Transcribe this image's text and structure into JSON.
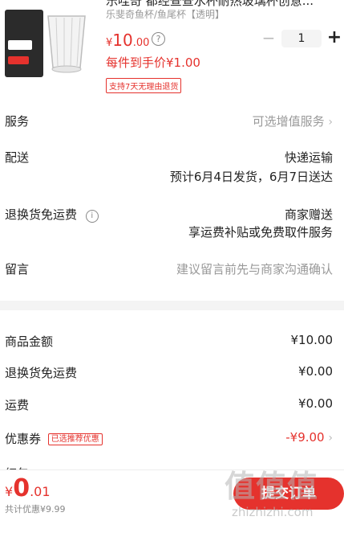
{
  "product": {
    "title": "乐哇奇 都经查查水杯耐热玻璃杯创意...",
    "spec": "乐斐奇鱼杯/鱼尾杯【透明】",
    "price": {
      "currency": "¥",
      "int": "10",
      "dec": ".00"
    },
    "info_icon": "?",
    "qty_minus": "−",
    "quantity": "1",
    "qty_plus": "+",
    "hand_price": "每件到手价¥1.00",
    "return_badge": "支持7天无理由退货"
  },
  "rows": {
    "service": {
      "label": "服务",
      "value": "可选增值服务"
    },
    "delivery": {
      "label": "配送",
      "value": "快递运输",
      "sub": "预计6月4日发货，6月7日送达"
    },
    "return_shipping": {
      "label": "退换货免运费",
      "value": "商家赠送",
      "sub": "享运费补贴或免费取件服务"
    },
    "message": {
      "label": "留言",
      "placeholder": "建议留言前先与商家沟通确认"
    }
  },
  "summary": {
    "goods_amount": {
      "label": "商品金额",
      "value": "¥10.00"
    },
    "return_fee": {
      "label": "退换货免运费",
      "value": "¥0.00"
    },
    "shipping": {
      "label": "运费",
      "value": "¥0.00"
    },
    "coupon": {
      "label": "优惠券",
      "tag": "已选推荐优惠",
      "value": "-¥9.00"
    },
    "peek_label": "红包"
  },
  "bottom": {
    "total_currency": "¥",
    "total_int": "0",
    "total_dec": ".01",
    "saved": "共计优惠¥9.99",
    "submit": "提交订单"
  },
  "watermark": {
    "main": "值值值",
    "url": "zhizhizhi.com"
  },
  "icons": {
    "chevron": "›",
    "question": "i"
  },
  "colors": {
    "accent": "#e5322d",
    "muted": "#999999",
    "divider": "#f4f4f4"
  }
}
